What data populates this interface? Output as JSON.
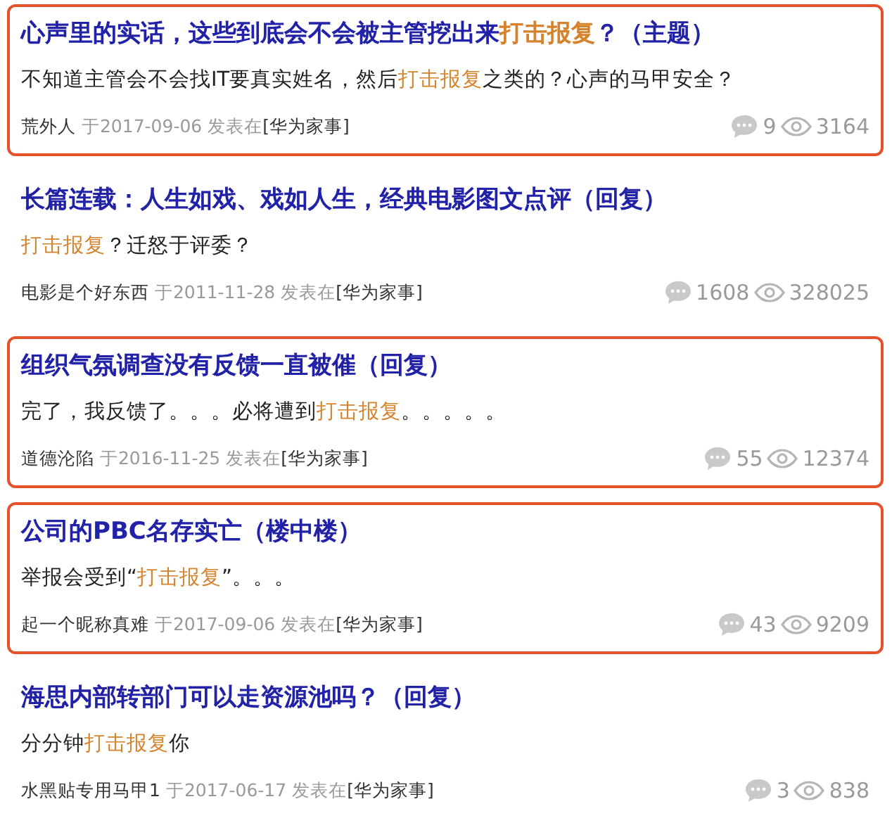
{
  "results": [
    {
      "marked": true,
      "title": [
        {
          "text": "心声里的实话，这些到底会不会被主管挖出来",
          "highlight": false
        },
        {
          "text": "打击报复",
          "highlight": true
        },
        {
          "text": "？（主题）",
          "highlight": false
        }
      ],
      "body": [
        {
          "text": "不知道主管会不会找IT要真实姓名，然后",
          "highlight": false
        },
        {
          "text": "打击报复",
          "highlight": true
        },
        {
          "text": "之类的？心声的马甲安全？",
          "highlight": false
        }
      ],
      "author": "荒外人",
      "posted": "于2017-09-06 发表在",
      "forum": "[华为家事]",
      "replies": "9",
      "views": "3164"
    },
    {
      "marked": false,
      "title": [
        {
          "text": "长篇连载：人生如戏、戏如人生，经典电影图文点评（回复）",
          "highlight": false
        }
      ],
      "body": [
        {
          "text": "打击报复",
          "highlight": true
        },
        {
          "text": "？迁怒于评委？",
          "highlight": false
        }
      ],
      "author": "电影是个好东西",
      "posted": "于2011-11-28 发表在",
      "forum": "[华为家事]",
      "replies": "1608",
      "views": "328025"
    },
    {
      "marked": true,
      "title": [
        {
          "text": "组织气氛调查没有反馈一直被催（回复）",
          "highlight": false
        }
      ],
      "body": [
        {
          "text": "完了，我反馈了。。。必将遭到",
          "highlight": false
        },
        {
          "text": "打击报复",
          "highlight": true
        },
        {
          "text": "。。。。。",
          "highlight": false
        }
      ],
      "author": "道德沦陷",
      "posted": "于2016-11-25 发表在",
      "forum": "[华为家事]",
      "replies": "55",
      "views": "12374"
    },
    {
      "marked": true,
      "title": [
        {
          "text": "公司的PBC名存实亡（楼中楼）",
          "highlight": false
        }
      ],
      "body": [
        {
          "text": "举报会受到“",
          "highlight": false
        },
        {
          "text": "打击报复",
          "highlight": true
        },
        {
          "text": "”。。。",
          "highlight": false
        }
      ],
      "author": "起一个昵称真难",
      "posted": "于2017-09-06 发表在",
      "forum": "[华为家事]",
      "replies": "43",
      "views": "9209"
    },
    {
      "marked": false,
      "title": [
        {
          "text": "海思内部转部门可以走资源池吗？（回复）",
          "highlight": false
        }
      ],
      "body": [
        {
          "text": "分分钟",
          "highlight": false
        },
        {
          "text": "打击报复",
          "highlight": true
        },
        {
          "text": "你",
          "highlight": false
        }
      ],
      "author": "水黑贴专用马甲1",
      "posted": "于2017-06-17 发表在",
      "forum": "[华为家事]",
      "replies": "3",
      "views": "838"
    }
  ]
}
